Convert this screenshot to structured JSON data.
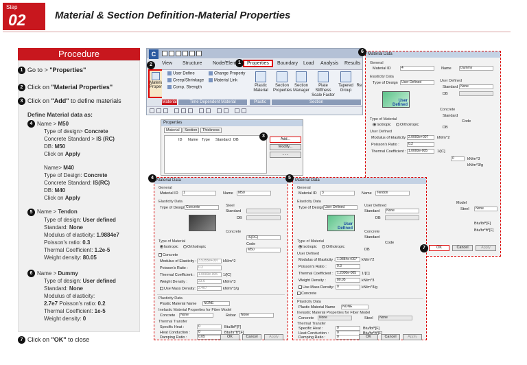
{
  "header": {
    "step_word": "Step",
    "step_num": "02",
    "title": "Material & Section Definition-Material Properties"
  },
  "procedure": {
    "heading": "Procedure",
    "step1": {
      "num": "1",
      "pre": "Go to > ",
      "bold": "\"Properties\""
    },
    "step2": {
      "num": "2",
      "pre": "Click ",
      "mid": "on ",
      "bold": "\"Material Properties\""
    },
    "step3": {
      "num": "3",
      "pre": "Click on ",
      "bold": "\"Add\"",
      "post": " to define materials"
    },
    "define_heading": "Define Material data as:",
    "step4": {
      "num": "4",
      "l1a": "Name > ",
      "l1b": "M50",
      "l2a": "Type of design> ",
      "l2b": "Concrete",
      "l3a": "Concrete Standard > ",
      "l3b": "IS (RC)",
      "l4a": "DB: ",
      "l4b": "M50",
      "l5": "Click on ",
      "l5b": "Apply"
    },
    "m40": {
      "l1a": "Name> ",
      "l1b": "M40",
      "l2a": "Type of Design: ",
      "l2b": "Concrete",
      "l3a": "Concrete Standard: ",
      "l3b": "IS(RC)",
      "l4a": "DB: ",
      "l4b": "M40",
      "l5": "Click on ",
      "l5b": "Apply"
    },
    "step5": {
      "num": "5",
      "l1a": "Name > ",
      "l1b": "Tendon",
      "l2a": "Type of design: ",
      "l2b": "User defined",
      "l3a": "Standard: ",
      "l3b": "None",
      "l4a": "Modulus of elasticity: ",
      "l4b": "1.9884e7",
      "l5a": "Poisson's ratio: ",
      "l5b": "0.3",
      "l6a": "Thermal Coefficient: ",
      "l6b": "1.2e-5",
      "l7a": "Weight density: ",
      "l7b": "80.05"
    },
    "step6": {
      "num": "6",
      "l1a": "Name > ",
      "l1b": "Dummy",
      "l2a": "Type of design: ",
      "l2b": "User defined",
      "l3a": "Standard: ",
      "l3b": "None",
      "l4": "Modulus of elasticity:",
      "l5a": "2.7e7",
      "l5b": " Poisson's ratio: ",
      "l5c": "0.2",
      "l6a": "Thermal Coefficient: ",
      "l6b": "1e-5",
      "l7a": "Weight density: ",
      "l7b": "0"
    },
    "step7": {
      "num": "7",
      "pre": "Click on ",
      "bold": "\"OK\"",
      "post": " to close"
    }
  },
  "app": {
    "logo": "C",
    "menus": [
      "View",
      "Structure",
      "Node/Element",
      "Properties",
      "Boundary",
      "Load",
      "Analysis",
      "Results"
    ],
    "ribbon": {
      "material_props": "Material Properties",
      "user_define": "User Define",
      "creep": "Creep/Shrinkage",
      "comp": "Comp. Strength",
      "change": "Change Property",
      "mat_link": "Material Link",
      "group_tdm": "Time Dependent Material",
      "group_material": "Material",
      "plastic": "Plastic Material",
      "group_plastic": "Plastic",
      "section_props": "Section Properties",
      "section_mgr": "Section Manager",
      "plate": "Plate Stiffness Scale Factor",
      "tapered": "Tapered Group",
      "re": "Re",
      "group_section": "Section"
    }
  },
  "callouts": [
    "1",
    "2",
    "3",
    "4",
    "5",
    "6",
    "7"
  ],
  "props_dialog": {
    "title": "Properties",
    "tabs": [
      "Material",
      "Section",
      "Thickness"
    ],
    "cols": [
      "ID",
      "Name",
      "Type",
      "Standard",
      "DB"
    ],
    "add": "Add...",
    "modify": "Modify...",
    "blank": "......"
  },
  "dlg_m50": {
    "title": "Material Data",
    "general": "General",
    "id_label": "Material ID",
    "id": "1",
    "name_label": "Name",
    "name": "M50",
    "elastic": "Elasticity Data",
    "type_label": "Type of Design",
    "type": "Concrete",
    "steel": "Steel",
    "standard_label": "Standard",
    "db_label": "DB",
    "concrete": "Concrete",
    "standard": "IS(RC)",
    "code_label": "Code",
    "db": "M50",
    "type_mat": "Type of Material",
    "isotropic": "Isotropic",
    "ortho": "Orthotropic",
    "concrete_chk": "Concrete",
    "mod_label": "Modulus of Elasticity :",
    "mod": "3.5355e+007",
    "mod_unit": "kN/m^2",
    "pois_label": "Poisson's Ratio :",
    "pois": "0.2",
    "therm_label": "Thermal Coefficient :",
    "therm": "1.0000e-005",
    "therm_unit": "1/[C]",
    "wd_label": "Weight Density :",
    "wd": "23.6",
    "wd_unit": "kN/m^3",
    "mass_label": "Use Mass Density:",
    "mass": "2.407",
    "mass_unit": "kN/m^3/g",
    "plast": "Plasticity Data",
    "plast_label": "Plastic Material Name",
    "plast_val": "NONE",
    "inelastic": "Inelastic Material Properties for Fiber Model",
    "conc2": "Concrete",
    "none1": "None",
    "rebar": "Rebar",
    "none2": "None",
    "thermal": "Thermal Transfer",
    "sh_label": "Specific Heat :",
    "sh": "0",
    "sh_unit": "Btu/lbf*[F]",
    "hc_label": "Heat Conduction :",
    "hc": "0",
    "hc_unit": "Btu/hr*ft*[F]",
    "damp_label": "Damping Ratio :",
    "damp": "0.05",
    "ok": "OK",
    "cancel": "Cancel",
    "apply": "Apply"
  },
  "dlg_tendon": {
    "title": "Material Data",
    "general": "General",
    "id_label": "Material ID",
    "id": "3",
    "name_label": "Name",
    "name": "Tendon",
    "elastic": "Elasticity Data",
    "type_label": "Type of Design",
    "type": "User Defined",
    "ud": "User Defined",
    "standard_label": "Standard",
    "standard": "None",
    "db_label": "DB",
    "box": "User Defined",
    "concrete": "Concrete",
    "std2": "Standard",
    "code_label": "Code",
    "db2": "DB",
    "type_mat": "Type of Material",
    "isotropic": "Isotropic",
    "ortho": "Orthotropic",
    "ud2": "User Defined",
    "mod_label": "Modulus of Elasticity :",
    "mod": "1.9884e+007",
    "mod_unit": "kN/m^2",
    "pois_label": "Poisson's Ratio :",
    "pois": "0.3",
    "therm_label": "Thermal Coefficient :",
    "therm": "1.2000e-005",
    "therm_unit": "1/[C]",
    "wd_label": "Weight Density :",
    "wd": "80.05",
    "wd_unit": "kN/m^3",
    "mass_label": "Use Mass Density:",
    "mass": "0",
    "mass_unit": "kN/m^3/g",
    "concrete_chk": "Concrete",
    "plast": "Plasticity Data",
    "plast_label": "Plastic Material Name",
    "plast_val": "NONE",
    "inelastic": "Inelastic Material Properties for Fiber Model",
    "conc2": "Concrete",
    "none1": "None",
    "steel2": "Steel",
    "none2": "None",
    "thermal": "Thermal Transfer",
    "sh_label": "Specific Heat :",
    "sh": "0",
    "sh_unit": "Btu/lbf*[F]",
    "hc_label": "Heat Conduction :",
    "hc": "0",
    "hc_unit": "Btu/hr*ft*[F]",
    "damp_label": "Damping Ratio :",
    "damp": "0",
    "ok": "OK",
    "cancel": "Cancel",
    "apply": "Apply"
  },
  "dlg_dummy": {
    "title": "Material Data",
    "general": "General",
    "id_label": "Material ID",
    "id": "4",
    "name_label": "Name",
    "name": "Dummy",
    "elastic": "Elasticity Data",
    "type_label": "Type of Design",
    "type": "User Defined",
    "ud": "User Defined",
    "standard_label": "Standard",
    "standard": "None",
    "db_label": "DB",
    "box": "User Defined",
    "concrete": "Concrete",
    "std2": "Standard",
    "code_label": "Code",
    "db2": "DB",
    "type_mat": "Type of Material",
    "isotropic": "Isotropic",
    "ortho": "Orthotropic",
    "ud2": "User Defined",
    "mod_label": "Modulus of Elasticity :",
    "mod": "2.0000e+007",
    "mod_unit": "kN/m^2",
    "pois_label": "Poisson's Ratio :",
    "pois": "0.2",
    "therm_label": "Thermal Coefficient :",
    "therm": "1.0000e-005",
    "therm_unit": "1/[C]",
    "wd": "0",
    "wd_unit": "kN/m^3",
    "mass_unit": "kN/m^3/g",
    "model": "Model",
    "steel": "Steel",
    "none": "None",
    "u1": "Btu/lbf*[F]",
    "u2": "Btu/hr*ft*[F]",
    "ok": "OK",
    "cancel": "Cancel",
    "apply": "Apply"
  }
}
